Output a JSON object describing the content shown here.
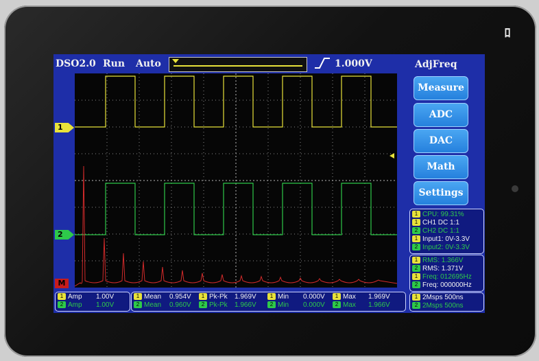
{
  "screen": {
    "app_name": "DSO2.0",
    "run_state": "Run",
    "trigger_mode": "Auto",
    "trigger_level": "1.000V",
    "menu_title": "AdjFreq",
    "colors": {
      "ch1": "#e8e23a",
      "ch2": "#2ec94a",
      "math": "#d12a2a",
      "background": "#1e2ea8"
    },
    "channel_markers": {
      "ch1": "1",
      "ch2": "2",
      "math": "M"
    },
    "menu_buttons": [
      "Measure",
      "ADC",
      "DAC",
      "Math",
      "Settings"
    ],
    "status_panel": [
      {
        "badge": "1",
        "text": "CPU: 99.31%"
      },
      {
        "badge": "1",
        "text": "CH1  DC 1:1"
      },
      {
        "badge": "2",
        "text": "CH2  DC 1:1"
      },
      {
        "badge": "1",
        "text": "Input1: 0V-3.3V"
      },
      {
        "badge": "2",
        "text": "Input2: 0V-3.3V"
      }
    ],
    "freq_panel": [
      {
        "badge": "1",
        "text": "RMS: 1.366V"
      },
      {
        "badge": "2",
        "text": "RMS: 1.371V"
      },
      {
        "badge": "1",
        "text": "Freq: 012695Hz"
      },
      {
        "badge": "2",
        "text": "Freq: 000000Hz"
      }
    ],
    "amp_panel": [
      {
        "badge": "1",
        "label": "Amp",
        "value": "1.00V"
      },
      {
        "badge": "2",
        "label": "Amp",
        "value": "1.00V"
      }
    ],
    "measure_panel": [
      [
        {
          "badge": "1",
          "label": "Mean",
          "value": "0.954V"
        },
        {
          "badge": "1",
          "label": "Pk-Pk",
          "value": "1.969V"
        },
        {
          "badge": "1",
          "label": "Min",
          "value": "0.000V"
        },
        {
          "badge": "1",
          "label": "Max",
          "value": "1.969V"
        }
      ],
      [
        {
          "badge": "2",
          "label": "Mean",
          "value": "0.960V"
        },
        {
          "badge": "2",
          "label": "Pk-Pk",
          "value": "1.966V"
        },
        {
          "badge": "2",
          "label": "Min",
          "value": "0.000V"
        },
        {
          "badge": "2",
          "label": "Max",
          "value": "1.966V"
        }
      ]
    ],
    "timebase_panel": [
      {
        "badge": "1",
        "text": "2Msps 500ns"
      },
      {
        "badge": "2",
        "text": "2Msps 500ns"
      }
    ]
  }
}
